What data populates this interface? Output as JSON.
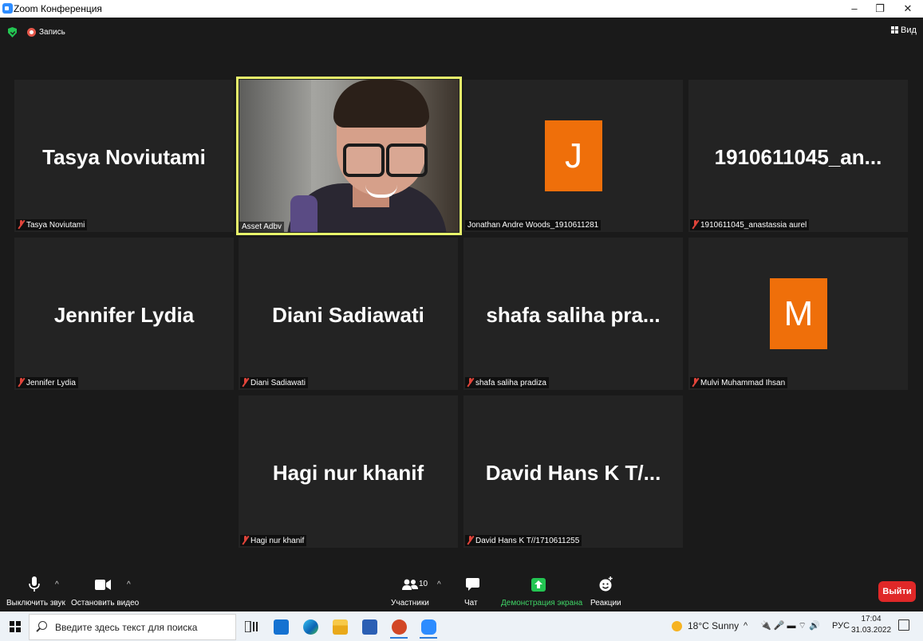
{
  "window": {
    "title": "Zoom Конференция",
    "minimize": "–",
    "maximize": "❐",
    "close": "✕"
  },
  "topbar": {
    "record_label": "Запись",
    "view_label": "Вид"
  },
  "tiles": [
    {
      "big_name": "Tasya Noviutami",
      "label": "Tasya Noviutami"
    },
    {
      "big_name": "",
      "label": "Asset Adbv"
    },
    {
      "big_name": "",
      "avatar_letter": "J",
      "label": "Jonathan Andre Woods_1910611281"
    },
    {
      "big_name": "1910611045_an...",
      "label": "1910611045_anastassia aurel"
    },
    {
      "big_name": "Jennifer Lydia",
      "label": "Jennifer Lydia"
    },
    {
      "big_name": "Diani Sadiawati",
      "label": "Diani Sadiawati"
    },
    {
      "big_name": "shafa saliha pra...",
      "label": "shafa saliha pradiza"
    },
    {
      "big_name": "",
      "avatar_letter": "M",
      "label": "Mulvi Muhammad Ihsan"
    },
    {
      "big_name": "Hagi nur khanif",
      "label": "Hagi nur khanif"
    },
    {
      "big_name": "David Hans K T/...",
      "label": "David Hans K T//1710611255"
    }
  ],
  "toolbar": {
    "mute_label": "Выключить звук",
    "video_label": "Остановить видео",
    "participants_label": "Участники",
    "participants_count": "10",
    "chat_label": "Чат",
    "share_label": "Демонстрация экрана",
    "reactions_label": "Реакции",
    "leave_label": "Выйти"
  },
  "colors": {
    "active_speaker_border": "#e8f56b",
    "avatar_orange": "#ef6f0a",
    "leave_red": "#e02828",
    "share_green": "#3fd466"
  },
  "taskbar": {
    "search_placeholder": "Введите здесь текст для поиска",
    "weather": "18°C  Sunny",
    "language": "РУС",
    "time": "17:04",
    "date": "31.03.2022"
  }
}
